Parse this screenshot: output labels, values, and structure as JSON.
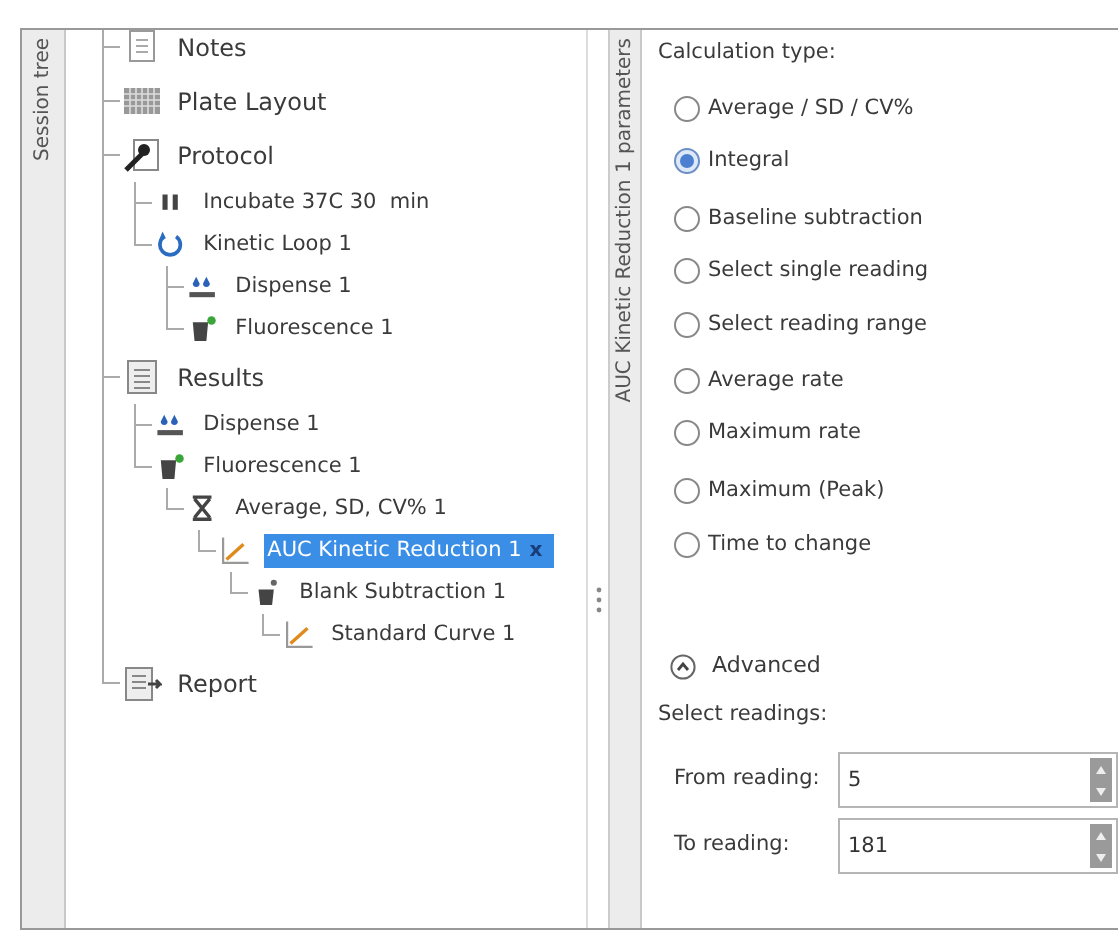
{
  "session_tab": {
    "label": "Session tree"
  },
  "tree": [
    {
      "label": "Notes",
      "kind": "notes",
      "selected": false
    },
    {
      "label": "Plate Layout",
      "kind": "plate",
      "selected": false
    },
    {
      "label": "Protocol",
      "kind": "protocol",
      "selected": false,
      "children": [
        {
          "label": "Incubate 37C 30  min",
          "kind": "step",
          "selected": false
        },
        {
          "label": "Kinetic Loop 1",
          "kind": "loop",
          "selected": false,
          "children": [
            {
              "label": "Dispense 1",
              "kind": "dispense",
              "selected": false
            },
            {
              "label": "Fluorescence 1",
              "kind": "fluorescence",
              "selected": false
            }
          ]
        }
      ]
    },
    {
      "label": "Results",
      "kind": "results",
      "selected": false,
      "children": [
        {
          "label": "Dispense 1",
          "kind": "dispense",
          "selected": false
        },
        {
          "label": "Fluorescence 1",
          "kind": "fluorescence",
          "selected": false,
          "children": [
            {
              "label": "Average, SD, CV% 1",
              "kind": "average",
              "selected": false,
              "children": [
                {
                  "label": "AUC Kinetic Reduction 1",
                  "kind": "curve",
                  "selected": true,
                  "close": "x",
                  "children": [
                    {
                      "label": "Blank Subtraction 1",
                      "kind": "blank",
                      "selected": false,
                      "children": [
                        {
                          "label": "Standard Curve 1",
                          "kind": "curve",
                          "selected": false
                        }
                      ]
                    }
                  ]
                }
              ]
            }
          ]
        }
      ]
    },
    {
      "label": "Report",
      "kind": "report",
      "selected": false
    }
  ],
  "params_tab": {
    "label": "AUC Kinetic Reduction 1 parameters"
  },
  "calculation": {
    "label": "Calculation type:",
    "options": [
      {
        "label": "Average / SD / CV%",
        "selected": false
      },
      {
        "label": "Integral",
        "selected": true
      },
      {
        "label": "Baseline subtraction",
        "selected": false
      },
      {
        "label": "Select single reading",
        "selected": false
      },
      {
        "label": "Select reading range",
        "selected": false
      },
      {
        "label": "Average rate",
        "selected": false
      },
      {
        "label": "Maximum rate",
        "selected": false
      },
      {
        "label": "Maximum (Peak)",
        "selected": false
      },
      {
        "label": "Time to change",
        "selected": false
      }
    ]
  },
  "advanced": {
    "label": "Advanced",
    "expanded": true
  },
  "readings": {
    "label": "Select readings:",
    "fields": [
      {
        "label": "From reading:",
        "value": "5"
      },
      {
        "label": "To reading:",
        "value": "181"
      }
    ]
  }
}
